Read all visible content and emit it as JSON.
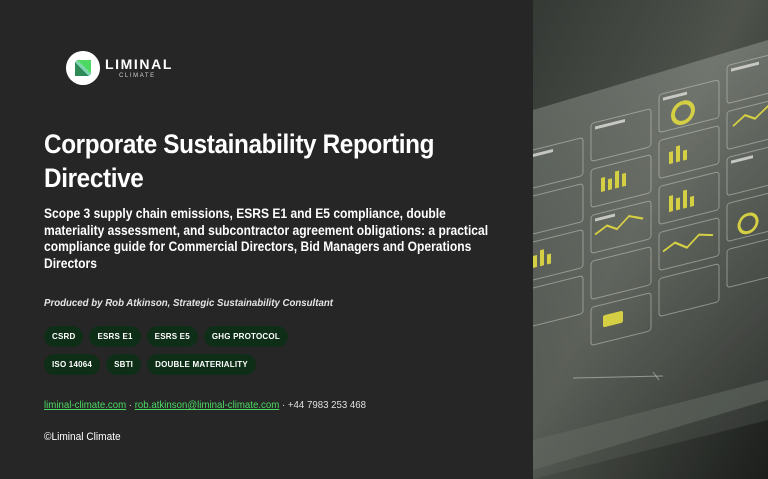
{
  "brand": {
    "name": "LIMINAL",
    "sub": "CLIMATE",
    "accent_color": "#4cd964",
    "logo_icon": "leaf-logo-icon"
  },
  "document": {
    "title": "Corporate Sustainability Reporting Directive",
    "subtitle": "Scope 3 supply chain emissions, ESRS E1 and E5 compliance, double materiality assessment, and subcontractor agreement obligations: a practical compliance guide for Commercial Directors, Bid Managers and Operations Directors",
    "byline": "Produced by Rob Atkinson, Strategic Sustainability Consultant"
  },
  "tags": [
    "CSRD",
    "ESRS E1",
    "ESRS E5",
    "GHG PROTOCOL",
    "ISO 14064",
    "SBTI",
    "DOUBLE MATERIALITY"
  ],
  "contact": {
    "website": "liminal-climate.com",
    "sep1": " · ",
    "email": "rob.atkinson@liminal-climate.com",
    "sep2": " · ",
    "phone": "+44 7983 253 468"
  },
  "footer": {
    "copyright": "©Liminal Climate"
  },
  "hero_image": {
    "description_icon": "dashboard-screens-image",
    "accent_color": "#e8e14a"
  }
}
